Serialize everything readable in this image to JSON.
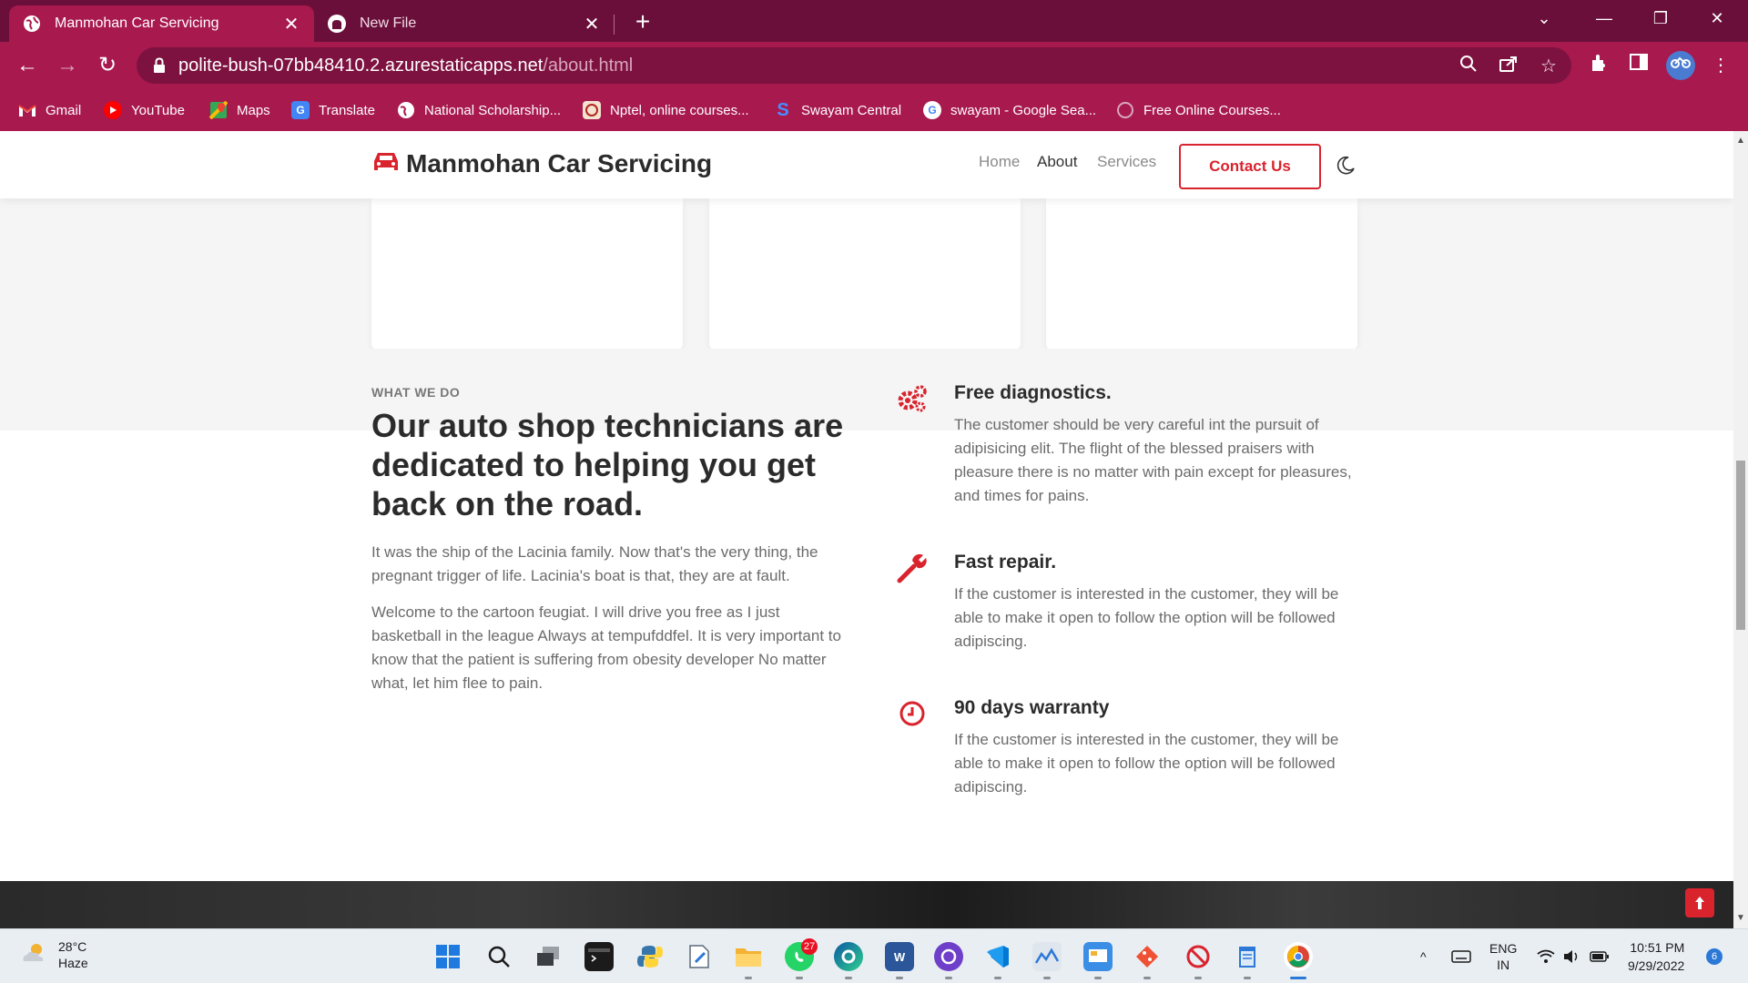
{
  "browser": {
    "tabs": [
      {
        "title": "Manmohan Car Servicing",
        "active": true,
        "icon": "globe-icon"
      },
      {
        "title": "New File",
        "active": false,
        "icon": "github-icon"
      }
    ],
    "url_host": "polite-bush-07bb48410.2.azurestaticapps.net",
    "url_path": "/about.html",
    "bookmarks": [
      {
        "label": "Gmail",
        "icon": "gmail-icon"
      },
      {
        "label": "YouTube",
        "icon": "youtube-icon"
      },
      {
        "label": "Maps",
        "icon": "maps-icon"
      },
      {
        "label": "Translate",
        "icon": "translate-icon"
      },
      {
        "label": "National Scholarship...",
        "icon": "globe-icon"
      },
      {
        "label": "Nptel, online courses...",
        "icon": "nptel-icon"
      },
      {
        "label": "Swayam Central",
        "icon": "swayam-icon"
      },
      {
        "label": "swayam - Google Sea...",
        "icon": "google-icon"
      },
      {
        "label": "Free Online Courses...",
        "icon": "globe-icon"
      }
    ]
  },
  "site": {
    "brand": "Manmohan Car Servicing",
    "nav": {
      "home": "Home",
      "about": "About",
      "services": "Services",
      "contact": "Contact Us"
    },
    "accent_color": "#d9232d"
  },
  "about": {
    "eyebrow": "WHAT WE DO",
    "headline": "Our auto shop technicians are dedicated to helping you get back on the road.",
    "para1": "It was the ship of the Lacinia family. Now that's the very thing, the pregnant trigger of life. Lacinia's boat is that, they are at fault.",
    "para2": "Welcome to the cartoon feugiat. I will drive you free as I just basketball in the league Always at tempufddfel. It is very important to know that the patient is suffering from obesity developer No matter what, let him flee to pain."
  },
  "features": [
    {
      "title": "Free diagnostics.",
      "icon": "gears-icon",
      "desc": "The customer should be very careful int the pursuit of adipisicing elit. The flight of the blessed praisers with pleasure there is no matter with pain except for pleasures, and times for pains."
    },
    {
      "title": "Fast repair.",
      "icon": "wrench-icon",
      "desc": "If the customer is interested in the customer, they will be able to make it open to follow the option will be followed adipiscing."
    },
    {
      "title": "90 days warranty",
      "icon": "clock-icon",
      "desc": "If the customer is interested in the customer, they will be able to make it open to follow the option will be followed adipiscing."
    }
  ],
  "taskbar": {
    "weather_temp": "28°C",
    "weather_desc": "Haze",
    "whatsapp_badge": "27",
    "lang_line1": "ENG",
    "lang_line2": "IN",
    "time": "10:51 PM",
    "date": "9/29/2022",
    "notification_count": "6"
  }
}
